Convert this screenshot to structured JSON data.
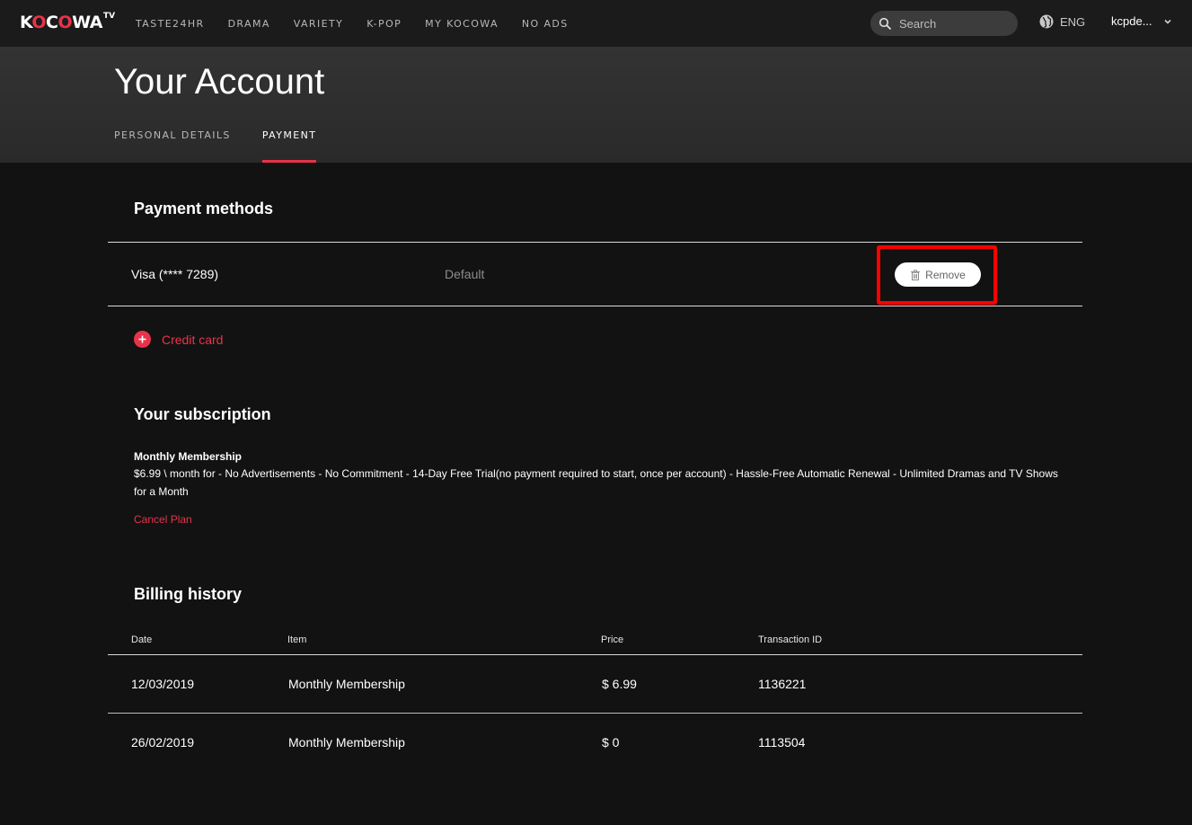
{
  "brand": {
    "word_a": "K",
    "word_o": "O",
    "word_b": "C",
    "word_o2": "O",
    "word_c": "WA",
    "tv": "TV"
  },
  "nav": {
    "links": [
      "TASTE24HR",
      "DRAMA",
      "VARIETY",
      "K-POP",
      "MY KOCOWA",
      "NO ADS"
    ],
    "search_placeholder": "Search",
    "language": "ENG",
    "user": "kcpde..."
  },
  "header": {
    "title": "Your Account",
    "tabs": [
      {
        "label": "PERSONAL DETAILS",
        "active": false
      },
      {
        "label": "PAYMENT",
        "active": true
      }
    ]
  },
  "payment_methods": {
    "title": "Payment methods",
    "card_label": "Visa (**** 7289)",
    "default_label": "Default",
    "remove_label": "Remove",
    "add_label": "Credit card"
  },
  "subscription": {
    "title": "Your subscription",
    "plan_name": "Monthly Membership",
    "plan_description": "$6.99 \\ month for - No Advertisements - No Commitment - 14-Day Free Trial(no payment required to start, once per account) - Hassle-Free Automatic Renewal - Unlimited Dramas and TV Shows for a Month",
    "cancel_label": "Cancel Plan"
  },
  "billing": {
    "title": "Billing history",
    "columns": [
      "Date",
      "Item",
      "Price",
      "Transaction ID"
    ],
    "rows": [
      {
        "date": "12/03/2019",
        "item": "Monthly Membership",
        "price": "$ 6.99",
        "transaction_id": "1136221"
      },
      {
        "date": "26/02/2019",
        "item": "Monthly Membership",
        "price": "$ 0",
        "transaction_id": "1113504"
      }
    ]
  },
  "colors": {
    "accent": "#e8334a",
    "highlight": "#ff0000",
    "background": "#121212"
  }
}
